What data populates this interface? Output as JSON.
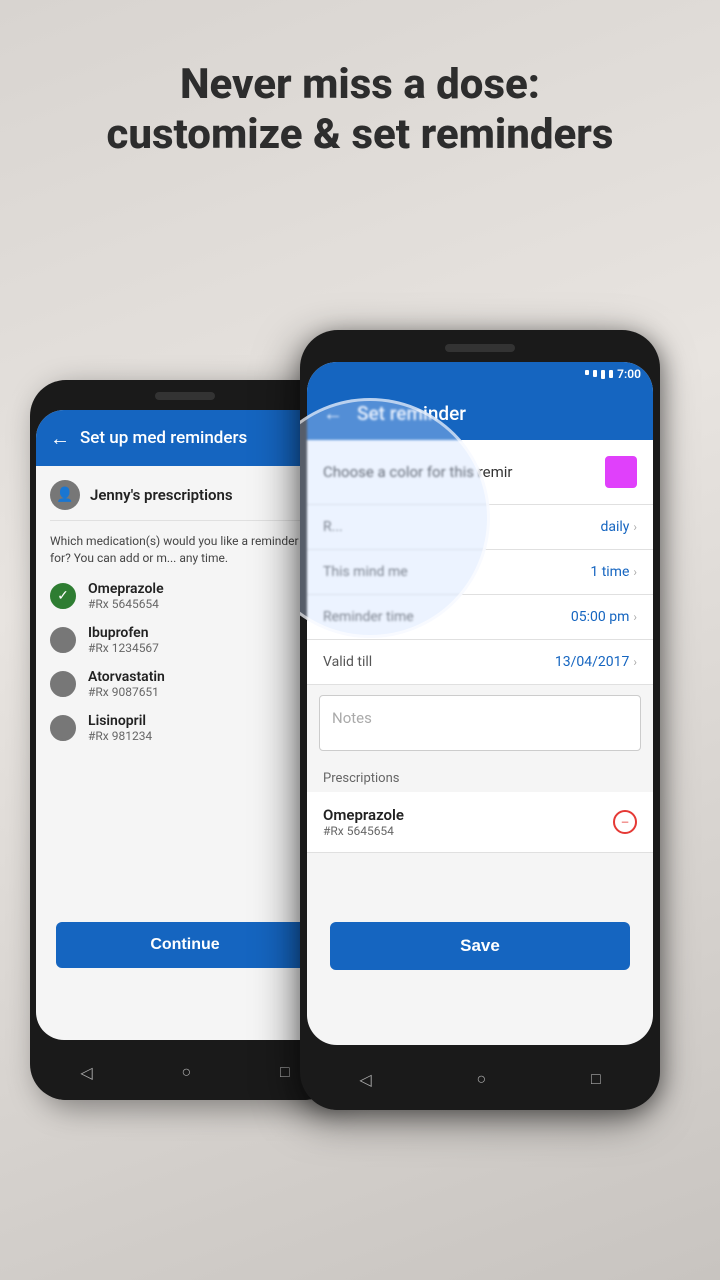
{
  "headline": {
    "line1": "Never miss a dose:",
    "line2": "customize & set reminders"
  },
  "phone1": {
    "header_title": "Set up med reminders",
    "jenny_name": "Jenny's prescriptions",
    "which_text": "Which medication(s) would you like a reminder for? You can add or m... any time.",
    "medications": [
      {
        "name": "Omeprazole",
        "rx": "#Rx 5645654",
        "checked": true
      },
      {
        "name": "Ibuprofen",
        "rx": "#Rx 1234567",
        "checked": false
      },
      {
        "name": "Atorvastatin",
        "rx": "#Rx 9087651",
        "checked": false
      },
      {
        "name": "Lisinopril",
        "rx": "#Rx 981234",
        "checked": false
      }
    ],
    "continue_label": "Continue"
  },
  "phone2": {
    "time": "7:00",
    "header_title": "Set reminder",
    "color_label": "Choose a color for this remir",
    "rows": [
      {
        "label": "R...",
        "value": "daily"
      },
      {
        "label": "This mind me",
        "value": "1 time"
      },
      {
        "label": "Reminder time",
        "value": "05:00 pm"
      },
      {
        "label": "Valid till",
        "value": "13/04/2017"
      }
    ],
    "notes_placeholder": "Notes",
    "prescriptions_label": "Prescriptions",
    "prescriptions": [
      {
        "name": "Omeprazole",
        "rx": "#Rx 5645654"
      }
    ],
    "save_label": "Save"
  },
  "nav": {
    "back": "◁",
    "home": "○",
    "recents": "□"
  }
}
